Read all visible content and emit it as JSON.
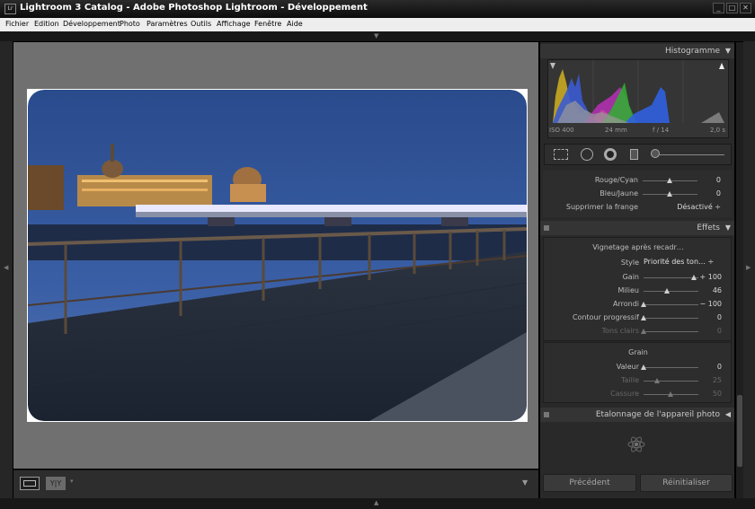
{
  "window": {
    "title": "Lightroom 3 Catalog - Adobe Photoshop Lightroom - Développement",
    "app_badge": "Lr",
    "minimize": "_",
    "maximize": "□",
    "close": "✕"
  },
  "menu": [
    "Fichier",
    "Edition",
    "Développement",
    "Photo",
    "Paramètres",
    "Outils",
    "Affichage",
    "Fenêtre",
    "Aide"
  ],
  "histogram": {
    "title": "Histogramme",
    "iso": "ISO 400",
    "focal": "24 mm",
    "aperture": "f / 14",
    "shutter": "2,0 s"
  },
  "hsl": {
    "rows": [
      {
        "label": "Rouge/Cyan",
        "value": "0",
        "pos": 0.5
      },
      {
        "label": "Bleu/Jaune",
        "value": "0",
        "pos": 0.5
      }
    ],
    "fringe_label": "Supprimer la frange",
    "fringe_value": "Désactivé ÷"
  },
  "effets": {
    "title": "Effets",
    "vignette_title": "Vignetage après recadr…",
    "style_label": "Style",
    "style_value": "Priorité des ton… ÷",
    "rows": [
      {
        "label": "Gain",
        "value": "+ 100",
        "pos": 0.92,
        "dim": false
      },
      {
        "label": "Milieu",
        "value": "46",
        "pos": 0.42,
        "dim": false
      },
      {
        "label": "Arrondi",
        "value": "− 100",
        "pos": 0.0,
        "dim": false
      },
      {
        "label": "Contour progressif",
        "value": "0",
        "pos": 0.0,
        "dim": false
      },
      {
        "label": "Tons clairs",
        "value": "0",
        "pos": 0.0,
        "dim": true
      }
    ],
    "grain_title": "Grain",
    "grain_rows": [
      {
        "label": "Valeur",
        "value": "0",
        "pos": 0.0,
        "dim": false
      },
      {
        "label": "Taille",
        "value": "25",
        "pos": 0.25,
        "dim": true
      },
      {
        "label": "Cassure",
        "value": "50",
        "pos": 0.5,
        "dim": true
      }
    ]
  },
  "calibration": {
    "title": "Etalonnage de l'appareil photo"
  },
  "buttons": {
    "previous": "Précédent",
    "reset": "Réinitialiser"
  },
  "toolbar": {
    "view_compare": "Y|Y"
  }
}
